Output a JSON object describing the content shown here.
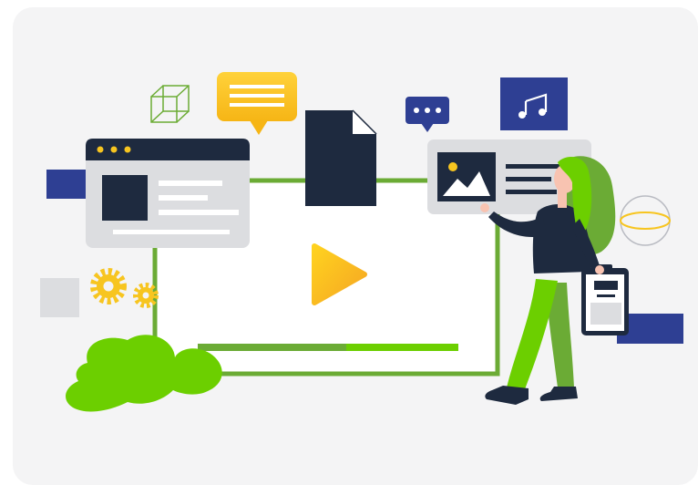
{
  "illustration": {
    "theme": "video content creation",
    "icons": [
      "wireframe-cube-icon",
      "chat-bubble-icon",
      "document-icon",
      "ellipsis-chat-icon",
      "music-note-icon",
      "image-icon",
      "gear-icon",
      "globe-icon",
      "clipboard-icon",
      "play-icon"
    ],
    "video_progress_fraction": 0.57
  },
  "colors": {
    "card_background": "#f4f4f5",
    "green": "#6bab35",
    "bright_green": "#6ccf00",
    "navy": "#1e2a3f",
    "indigo": "#2e3f93",
    "yellow": "#f7c520",
    "gray_panel": "#dcdde0"
  }
}
